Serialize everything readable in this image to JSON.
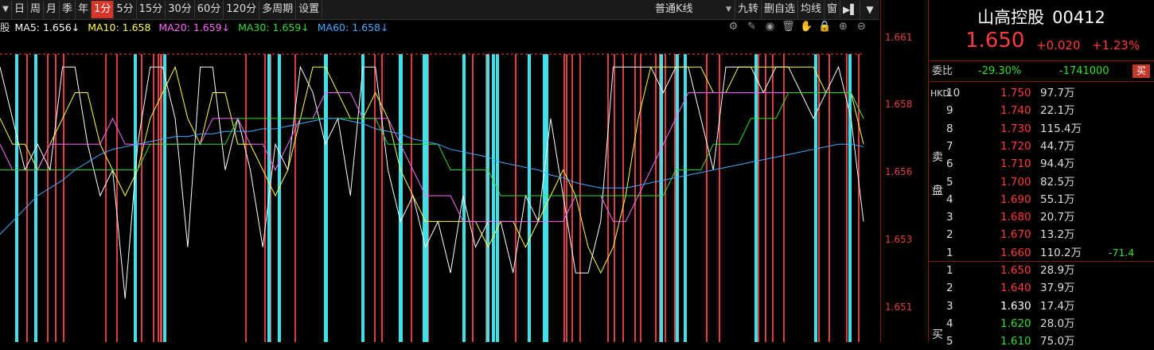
{
  "toolbar": {
    "periods": [
      "日",
      "周",
      "月",
      "季",
      "年",
      "1分",
      "5分",
      "15分",
      "30分",
      "60分",
      "120分",
      "多周期",
      "设置"
    ],
    "active_index": 5,
    "kline_type": "普通K线",
    "tools": [
      "九转",
      "删自选",
      "均线",
      "窗"
    ]
  },
  "ma": {
    "prefix": "股",
    "ma5": "MA5: 1.656↓",
    "ma10": "MA10: 1.658",
    "ma20": "MA20: 1.659↓",
    "ma30": "MA30: 1.659↓",
    "ma60": "MA60: 1.658↓",
    "colors": {
      "ma5": "#ffffff",
      "ma10": "#ffff44",
      "ma20": "#ff66ff",
      "ma30": "#33dd33",
      "ma60": "#44aaff"
    }
  },
  "y_axis": {
    "labels": [
      "1.661",
      "1.658",
      "1.656",
      "1.653",
      "1.651"
    ],
    "min": 1.6505,
    "max": 1.6615
  },
  "chart_data": {
    "type": "line",
    "series": [
      {
        "name": "MA5",
        "values": [
          1.661,
          1.659,
          1.657,
          1.658,
          1.657,
          1.661,
          1.661,
          1.658,
          1.656,
          1.657,
          1.652,
          1.658,
          1.661,
          1.661,
          1.659,
          1.654,
          1.661,
          1.661,
          1.657,
          1.659,
          1.657,
          1.654,
          1.658,
          1.657,
          1.661,
          1.66,
          1.658,
          1.659,
          1.656,
          1.661,
          1.661,
          1.657,
          1.655,
          1.656,
          1.654,
          1.655,
          1.653,
          1.656,
          1.654,
          1.655,
          1.655,
          1.653,
          1.656,
          1.655,
          1.659,
          1.656,
          1.653,
          1.653,
          1.655,
          1.661,
          1.661,
          1.661,
          1.661,
          1.66,
          1.661,
          1.661,
          1.659,
          1.657,
          1.661,
          1.661,
          1.661,
          1.66,
          1.661,
          1.661,
          1.66,
          1.659,
          1.66,
          1.661,
          1.659,
          1.655
        ]
      },
      {
        "name": "MA10",
        "values": [
          1.659,
          1.658,
          1.658,
          1.657,
          1.658,
          1.659,
          1.66,
          1.66,
          1.658,
          1.657,
          1.656,
          1.657,
          1.659,
          1.66,
          1.661,
          1.659,
          1.658,
          1.66,
          1.66,
          1.658,
          1.658,
          1.657,
          1.656,
          1.657,
          1.659,
          1.661,
          1.661,
          1.66,
          1.659,
          1.659,
          1.66,
          1.659,
          1.657,
          1.656,
          1.655,
          1.655,
          1.655,
          1.655,
          1.655,
          1.654,
          1.655,
          1.655,
          1.654,
          1.655,
          1.656,
          1.657,
          1.656,
          1.654,
          1.653,
          1.654,
          1.656,
          1.659,
          1.661,
          1.661,
          1.661,
          1.661,
          1.661,
          1.66,
          1.66,
          1.661,
          1.661,
          1.661,
          1.661,
          1.661,
          1.661,
          1.661,
          1.66,
          1.66,
          1.66,
          1.658
        ]
      },
      {
        "name": "MA20",
        "values": [
          1.658,
          1.657,
          1.657,
          1.657,
          1.658,
          1.658,
          1.658,
          1.658,
          1.658,
          1.659,
          1.658,
          1.658,
          1.658,
          1.658,
          1.658,
          1.658,
          1.658,
          1.659,
          1.659,
          1.659,
          1.658,
          1.658,
          1.657,
          1.658,
          1.659,
          1.659,
          1.66,
          1.66,
          1.66,
          1.659,
          1.659,
          1.659,
          1.658,
          1.657,
          1.656,
          1.656,
          1.656,
          1.655,
          1.655,
          1.655,
          1.655,
          1.655,
          1.655,
          1.655,
          1.655,
          1.655,
          1.656,
          1.656,
          1.656,
          1.655,
          1.655,
          1.656,
          1.657,
          1.658,
          1.659,
          1.66,
          1.66,
          1.66,
          1.66,
          1.66,
          1.66,
          1.66,
          1.66,
          1.66,
          1.66,
          1.66,
          1.66,
          1.66,
          1.66,
          1.659
        ]
      },
      {
        "name": "MA30",
        "values": [
          1.657,
          1.657,
          1.657,
          1.657,
          1.657,
          1.657,
          1.657,
          1.657,
          1.657,
          1.657,
          1.657,
          1.657,
          1.658,
          1.658,
          1.658,
          1.658,
          1.658,
          1.658,
          1.658,
          1.659,
          1.659,
          1.659,
          1.659,
          1.659,
          1.659,
          1.659,
          1.659,
          1.659,
          1.659,
          1.659,
          1.659,
          1.658,
          1.658,
          1.658,
          1.658,
          1.658,
          1.657,
          1.657,
          1.657,
          1.657,
          1.656,
          1.656,
          1.656,
          1.656,
          1.656,
          1.656,
          1.656,
          1.656,
          1.656,
          1.656,
          1.656,
          1.656,
          1.656,
          1.656,
          1.657,
          1.657,
          1.657,
          1.658,
          1.658,
          1.658,
          1.659,
          1.659,
          1.659,
          1.66,
          1.66,
          1.66,
          1.66,
          1.66,
          1.66,
          1.659
        ]
      },
      {
        "name": "MA60",
        "values": [
          1.6545,
          1.655,
          1.6555,
          1.656,
          1.6563,
          1.6566,
          1.657,
          1.6573,
          1.6576,
          1.6578,
          1.6579,
          1.658,
          1.6581,
          1.6582,
          1.6583,
          1.6583,
          1.6584,
          1.6584,
          1.6585,
          1.6585,
          1.6585,
          1.6586,
          1.6586,
          1.6587,
          1.6588,
          1.6589,
          1.659,
          1.659,
          1.6589,
          1.6588,
          1.6586,
          1.6585,
          1.6584,
          1.6582,
          1.6581,
          1.658,
          1.6578,
          1.6577,
          1.6576,
          1.6575,
          1.6573,
          1.6572,
          1.6571,
          1.657,
          1.6568,
          1.6567,
          1.6565,
          1.6564,
          1.6563,
          1.6563,
          1.6563,
          1.6564,
          1.6565,
          1.6566,
          1.6567,
          1.6568,
          1.6569,
          1.657,
          1.6571,
          1.6572,
          1.6573,
          1.6574,
          1.6575,
          1.6576,
          1.6577,
          1.6578,
          1.6579,
          1.658,
          1.658,
          1.6579
        ]
      }
    ],
    "ylim": [
      1.6505,
      1.6615
    ],
    "grid": false
  },
  "vbars": {
    "note_colors": {
      "up": "#ff4a4a",
      "down": "#40e0e8"
    },
    "up_count": 48,
    "down_count": 26
  },
  "panel": {
    "name": "山高控股",
    "code": "00412",
    "price": "1.650",
    "change": "+0.020",
    "change_pct": "+1.23%",
    "weibi_label": "委比",
    "weibi_pct": "-29.30%",
    "weibi_diff": "-1741000",
    "buy_btn": "买",
    "currency": "HKD",
    "sell_label": "卖盘",
    "buy_label": "买",
    "asks": [
      {
        "lvl": "10",
        "price": "1.750",
        "vol": "97.7万",
        "color": "#ff3b3b",
        "extra": ""
      },
      {
        "lvl": "9",
        "price": "1.740",
        "vol": "22.1万",
        "color": "#ff3b3b",
        "extra": ""
      },
      {
        "lvl": "8",
        "price": "1.730",
        "vol": "115.4万",
        "color": "#ff3b3b",
        "extra": ""
      },
      {
        "lvl": "7",
        "price": "1.720",
        "vol": "44.7万",
        "color": "#ff3b3b",
        "extra": ""
      },
      {
        "lvl": "6",
        "price": "1.710",
        "vol": "94.4万",
        "color": "#ff3b3b",
        "extra": ""
      },
      {
        "lvl": "5",
        "price": "1.700",
        "vol": "82.5万",
        "color": "#ff3b3b",
        "extra": ""
      },
      {
        "lvl": "4",
        "price": "1.690",
        "vol": "55.1万",
        "color": "#ff3b3b",
        "extra": ""
      },
      {
        "lvl": "3",
        "price": "1.680",
        "vol": "20.7万",
        "color": "#ff3b3b",
        "extra": ""
      },
      {
        "lvl": "2",
        "price": "1.670",
        "vol": "13.2万",
        "color": "#ff3b3b",
        "extra": ""
      },
      {
        "lvl": "1",
        "price": "1.660",
        "vol": "110.2万",
        "color": "#ff3b3b",
        "extra": "-71.4"
      }
    ],
    "bids": [
      {
        "lvl": "1",
        "price": "1.650",
        "vol": "28.9万",
        "color": "#ff3b3b"
      },
      {
        "lvl": "2",
        "price": "1.640",
        "vol": "37.9万",
        "color": "#ff3b3b"
      },
      {
        "lvl": "3",
        "price": "1.630",
        "vol": "17.4万",
        "color": "#ffffff"
      },
      {
        "lvl": "4",
        "price": "1.620",
        "vol": "28.0万",
        "color": "#33dd33"
      },
      {
        "lvl": "5",
        "price": "1.610",
        "vol": "75.0万",
        "color": "#33dd33"
      }
    ]
  }
}
